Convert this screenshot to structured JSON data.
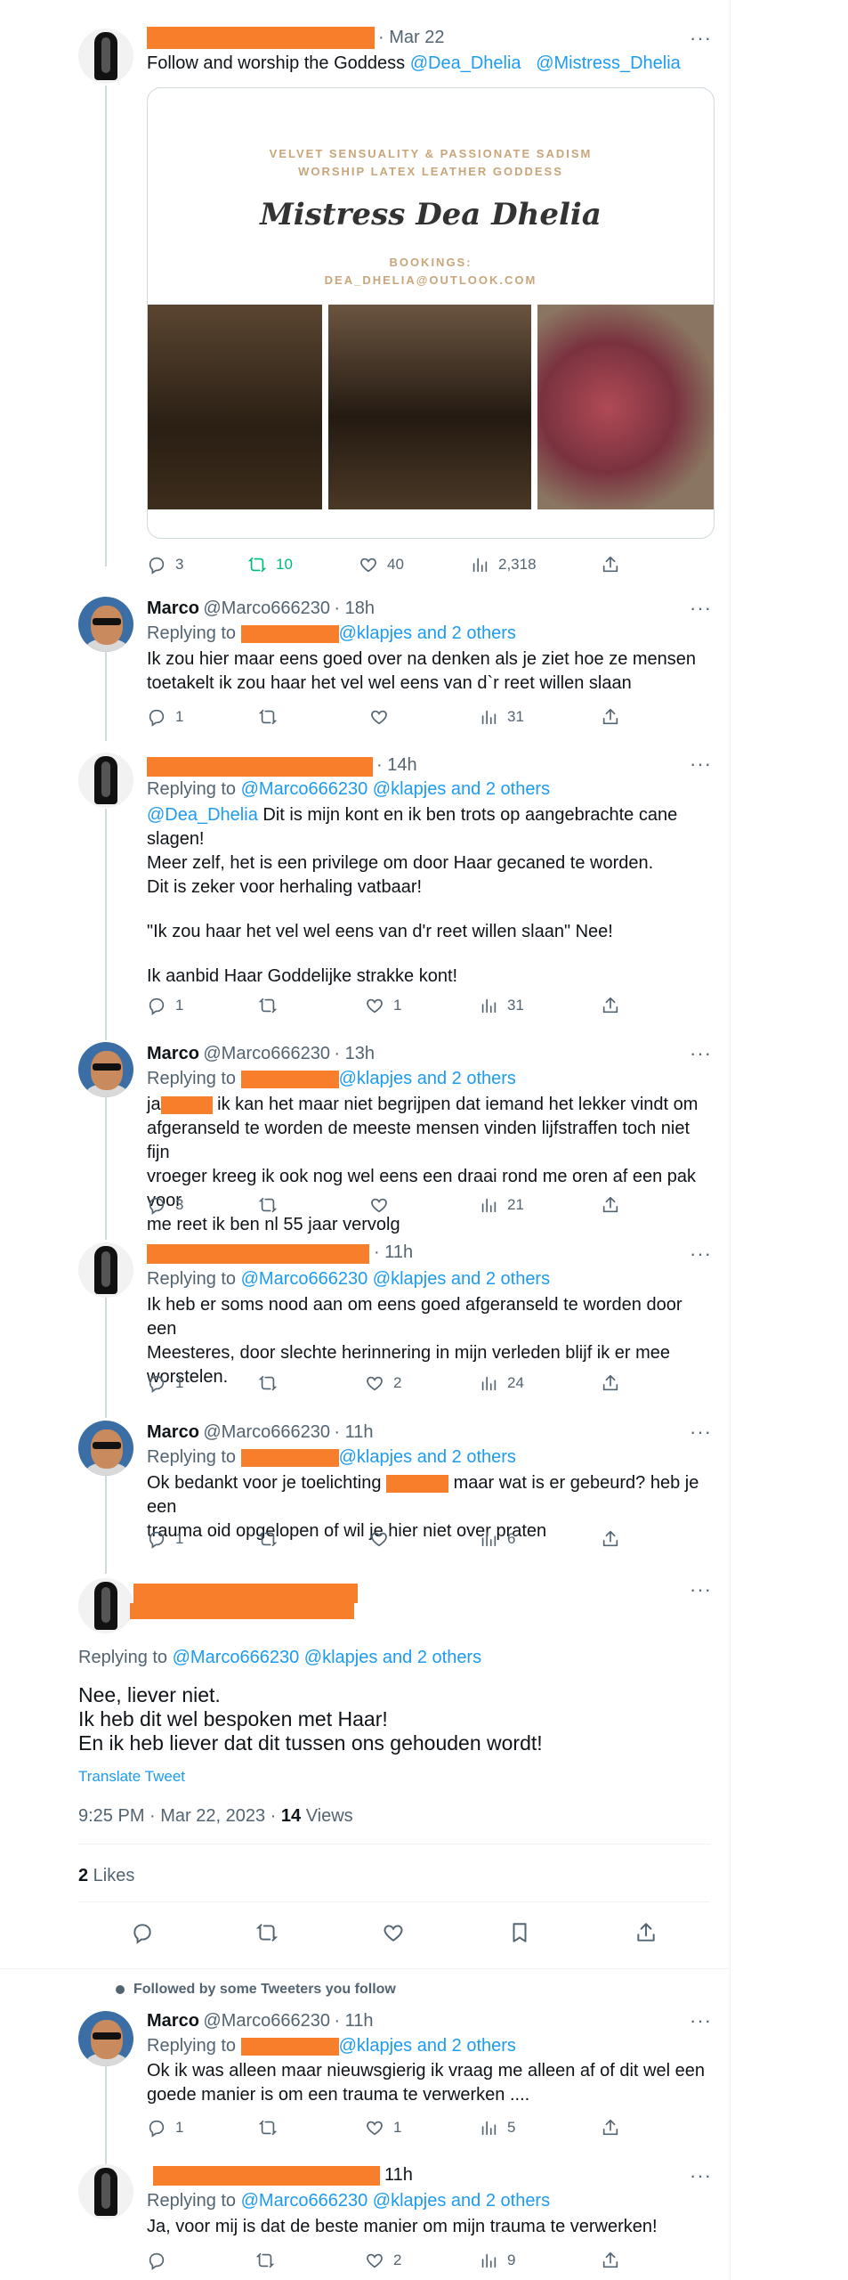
{
  "tweets": [
    {
      "date": "· Mar 22",
      "text_prefix": "Follow and worship the Goddess ",
      "mention1": "@Dea_Dhelia",
      "mention2": "@Mistress_Dhelia",
      "card": {
        "line1": "VELVET SENSUALITY & PASSIONATE SADISM",
        "line2": "WORSHIP LATEX LEATHER GODDESS",
        "title": "Mistress Dea Dhelia",
        "bookings": "BOOKINGS:",
        "email": "DEA_DHELIA@OUTLOOK.COM"
      },
      "stats": {
        "replies": "3",
        "retweets": "10",
        "likes": "40",
        "views": "2,318"
      }
    },
    {
      "name": "Marco",
      "handle": "@Marco666230",
      "time": "· 18h",
      "replying_label": "Replying to",
      "replying_rest": "@klapjes and 2 others",
      "text": [
        "Ik zou hier maar eens goed over na denken als je ziet hoe ze mensen",
        "toetakelt ik zou haar het vel wel eens van d`r reet willen slaan"
      ],
      "stats": {
        "replies": "1",
        "retweets": "",
        "likes": "",
        "views": "31"
      }
    },
    {
      "time": "· 14h",
      "replying_label": "Replying to",
      "replying_rest": "@Marco666230 @klapjes and 2 others",
      "mention": "@Dea_Dhelia",
      "text": [
        " Dit is mijn kont en ik ben trots op aangebrachte cane",
        "slagen!",
        "Meer zelf, het is een privilege om door Haar gecaned te worden.",
        "Dit is zeker voor herhaling vatbaar!",
        "",
        "\"Ik zou haar het vel wel eens van d'r reet willen slaan\" Nee!",
        "",
        "Ik aanbid Haar Goddelijke strakke kont!"
      ],
      "stats": {
        "replies": "1",
        "retweets": "",
        "likes": "1",
        "views": "31"
      }
    },
    {
      "name": "Marco",
      "handle": "@Marco666230",
      "time": "· 13h",
      "replying_label": "Replying to",
      "replying_rest": "@klapjes and 2 others",
      "text_start": "ja",
      "text": [
        " ik kan het maar niet begrijpen dat iemand het lekker vindt om",
        "afgeranseld te worden de meeste mensen vinden lijfstraffen toch niet fijn",
        "vroeger kreeg ik ook nog wel eens een draai rond me oren af een pak voor",
        "me reet ik ben nl 55 jaar vervolg"
      ],
      "stats": {
        "replies": "3",
        "retweets": "",
        "likes": "",
        "views": "21"
      }
    },
    {
      "time": "· 11h",
      "replying_label": "Replying to",
      "replying_rest": "@Marco666230 @klapjes and 2 others",
      "text": [
        "Ik heb er soms nood aan om eens goed afgeranseld te worden door een",
        "Meesteres, door slechte herinnering in mijn verleden blijf ik er mee",
        "worstelen."
      ],
      "stats": {
        "replies": "1",
        "retweets": "",
        "likes": "2",
        "views": "24"
      }
    },
    {
      "name": "Marco",
      "handle": "@Marco666230",
      "time": "· 11h",
      "replying_label": "Replying to",
      "replying_rest": "@klapjes and 2 others",
      "text_start": "Ok bedankt voor je toelichting",
      "text_end": "maar wat is er gebeurd? heb je een",
      "text2": "trauma oid opgelopen of wil je hier niet over praten",
      "stats": {
        "replies": "1",
        "retweets": "",
        "likes": "",
        "views": "6"
      }
    }
  ],
  "main": {
    "replying_label": "Replying to",
    "replying_rest": "@Marco666230 @klapjes and 2 others",
    "text": [
      "Nee, liever niet.",
      "Ik heb dit wel bespoken met Haar!",
      "En ik heb liever dat dit tussen ons gehouden wordt!"
    ],
    "translate": "Translate Tweet",
    "timestamp": "9:25 PM · Mar 22, 2023 · ",
    "views_count": "14",
    "views_label": " Views",
    "likes_count": "2",
    "likes_label": " Likes"
  },
  "followed_by": "Followed by some Tweeters you follow",
  "reply1": {
    "name": "Marco",
    "handle": "@Marco666230",
    "time": "· 11h",
    "replying_label": "Replying to",
    "replying_rest": "@klapjes and 2 others",
    "text": [
      "Ok ik was alleen maar nieuwsgierig ik vraag me alleen af of dit wel een",
      "goede manier is om een trauma te verwerken ...."
    ],
    "stats": {
      "replies": "1",
      "retweets": "",
      "likes": "1",
      "views": "5"
    }
  },
  "reply2": {
    "time": "11h",
    "replying_label": "Replying to",
    "replying_rest": "@Marco666230 @klapjes and 2 others",
    "text": "Ja, voor mij is dat de beste manier om mijn trauma te verwerken!",
    "stats": {
      "replies": "",
      "retweets": "",
      "likes": "2",
      "views": "9"
    }
  },
  "colors": {
    "accent": "#1d9bf0",
    "redaction": "#f77f2b",
    "retweet_active": "#00ba7c",
    "secondary": "#536471"
  },
  "more_label": "···"
}
